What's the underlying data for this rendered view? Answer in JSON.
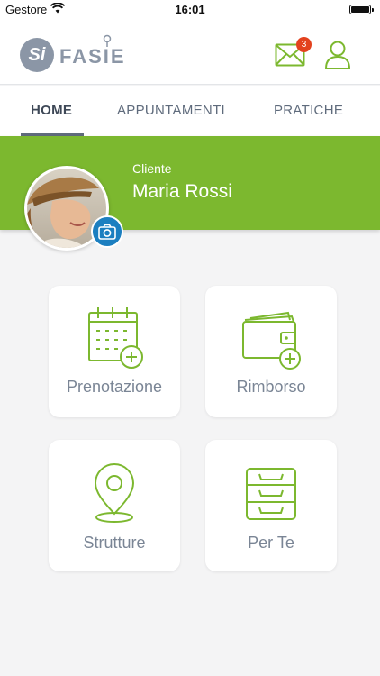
{
  "status_bar": {
    "carrier": "Gestore",
    "time": "16:01"
  },
  "header": {
    "logo_mark": "Si",
    "logo_text": "FASIE",
    "mail_badge": "3",
    "icons": {
      "mail": "mail-icon",
      "user": "user-icon"
    }
  },
  "tabs": [
    {
      "label": "HOME",
      "active": true
    },
    {
      "label": "APPUNTAMENTI",
      "active": false
    },
    {
      "label": "PRATICHE",
      "active": false
    }
  ],
  "profile": {
    "role": "Cliente",
    "name": "Maria Rossi"
  },
  "cards": [
    {
      "label": "Prenotazione",
      "icon": "calendar-add-icon"
    },
    {
      "label": "Rimborso",
      "icon": "wallet-add-icon"
    },
    {
      "label": "Strutture",
      "icon": "location-pin-icon"
    },
    {
      "label": "Per Te",
      "icon": "drawers-icon"
    }
  ],
  "colors": {
    "accent_green": "#7cb82f",
    "badge_red": "#e3421e",
    "camera_blue": "#1c7fc0",
    "text_gray": "#7a8595"
  }
}
